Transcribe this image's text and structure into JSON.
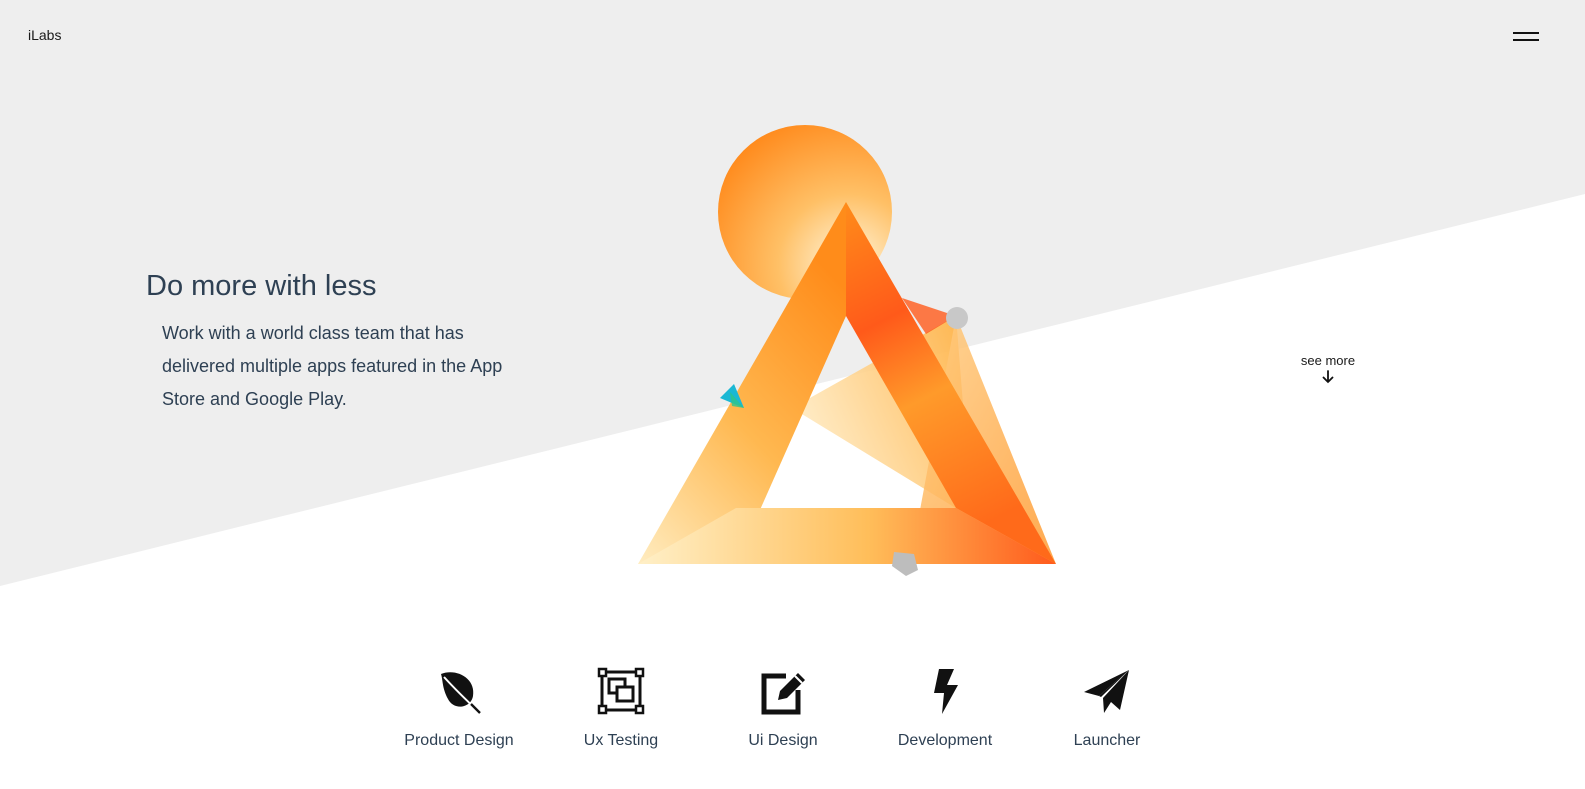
{
  "brand": {
    "logo_text": "iLabs"
  },
  "header": {
    "menu_icon": "hamburger-menu-icon"
  },
  "hero": {
    "title": "Do more with less",
    "description": "Work with a world class team that has delivered multiple apps featured in the App Store and Google Play."
  },
  "see_more": {
    "label": "see more",
    "icon": "arrow-down-icon"
  },
  "services": [
    {
      "label": "Product Design",
      "icon": "leaf-icon"
    },
    {
      "label": "Ux Testing",
      "icon": "layers-frame-icon"
    },
    {
      "label": "Ui Design",
      "icon": "edit-square-icon"
    },
    {
      "label": "Development",
      "icon": "lightning-bolt-icon"
    },
    {
      "label": "Launcher",
      "icon": "paper-plane-icon"
    }
  ],
  "colors": {
    "background_gray": "#eeeeee",
    "text_dark": "#2e4053",
    "accent_orange": "#ff8c1a",
    "accent_red": "#ff4a1a",
    "accent_cyan": "#1bb8d4"
  }
}
